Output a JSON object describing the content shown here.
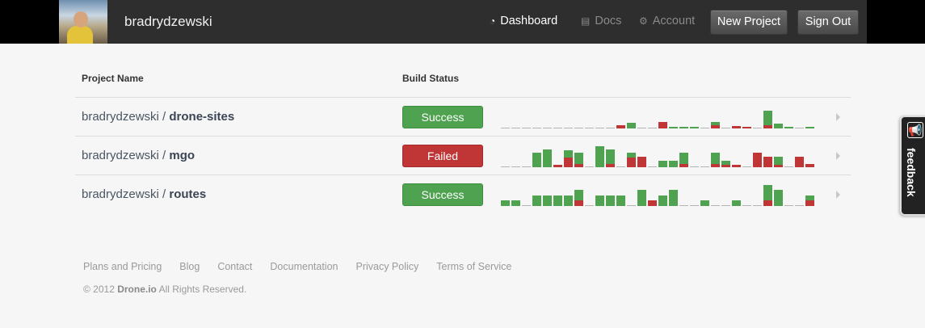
{
  "header": {
    "username": "bradrydzewski",
    "nav": [
      {
        "label": "Dashboard",
        "icon": "dashboard-icon",
        "active": true
      },
      {
        "label": "Docs",
        "icon": "document-icon",
        "active": false
      },
      {
        "label": "Account",
        "icon": "gear-icon",
        "active": false
      }
    ],
    "new_project_label": "New Project",
    "sign_out_label": "Sign Out"
  },
  "table": {
    "col_project": "Project Name",
    "col_status": "Build Status",
    "rows": [
      {
        "owner": "bradrydzewski / ",
        "repo": "drone-sites",
        "status": "Success",
        "status_kind": "success",
        "builds": [
          {
            "r": "p"
          },
          {
            "r": "p"
          },
          {
            "r": "p"
          },
          {
            "r": "p"
          },
          {
            "r": "p"
          },
          {
            "r": "p"
          },
          {
            "r": "p"
          },
          {
            "r": "p"
          },
          {
            "r": "p"
          },
          {
            "r": "p"
          },
          {
            "r": "p"
          },
          {
            "r": "f",
            "h": 0.2
          },
          {
            "r": "s",
            "h": 0.3
          },
          {
            "r": "p"
          },
          {
            "r": "p"
          },
          {
            "r": "f",
            "h": 0.35
          },
          {
            "r": "s",
            "h": 0.08
          },
          {
            "r": "s",
            "h": 0.08
          },
          {
            "r": "s",
            "h": 0.08
          },
          {
            "r": "p"
          },
          {
            "r": "m",
            "h": 0.36,
            "f": 0.18
          },
          {
            "r": "p"
          },
          {
            "r": "f",
            "h": 0.15
          },
          {
            "r": "f",
            "h": 0.1
          },
          {
            "r": "p"
          },
          {
            "r": "m",
            "h": 1.0,
            "f": 0.2
          },
          {
            "r": "s",
            "h": 0.28
          },
          {
            "r": "s",
            "h": 0.08
          },
          {
            "r": "p"
          },
          {
            "r": "s",
            "h": 0.08
          }
        ]
      },
      {
        "owner": "bradrydzewski / ",
        "repo": "mgo",
        "status": "Failed",
        "status_kind": "failed",
        "builds": [
          {
            "r": "p"
          },
          {
            "r": "p"
          },
          {
            "r": "p"
          },
          {
            "r": "s",
            "h": 0.8
          },
          {
            "r": "s",
            "h": 1.0
          },
          {
            "r": "f",
            "h": 0.15
          },
          {
            "r": "m",
            "h": 0.95,
            "f": 0.55
          },
          {
            "r": "m",
            "h": 0.8,
            "f": 0.2
          },
          {
            "r": "p"
          },
          {
            "r": "s",
            "h": 1.2
          },
          {
            "r": "m",
            "h": 1.0,
            "f": 0.2
          },
          {
            "r": "p"
          },
          {
            "r": "m",
            "h": 0.8,
            "f": 0.55
          },
          {
            "r": "f",
            "h": 0.6
          },
          {
            "r": "p"
          },
          {
            "r": "s",
            "h": 0.38
          },
          {
            "r": "s",
            "h": 0.38
          },
          {
            "r": "m",
            "h": 0.8,
            "f": 0.2
          },
          {
            "r": "p"
          },
          {
            "r": "p"
          },
          {
            "r": "m",
            "h": 0.8,
            "f": 0.2
          },
          {
            "r": "m",
            "h": 0.35,
            "f": 0.15
          },
          {
            "r": "f",
            "h": 0.15
          },
          {
            "r": "p"
          },
          {
            "r": "f",
            "h": 0.8
          },
          {
            "r": "m",
            "h": 0.6,
            "f": 0.58
          },
          {
            "r": "m",
            "h": 0.6,
            "f": 0.15
          },
          {
            "r": "p"
          },
          {
            "r": "f",
            "h": 0.6
          },
          {
            "r": "f",
            "h": 0.18
          }
        ]
      },
      {
        "owner": "bradrydzewski / ",
        "repo": "routes",
        "status": "Success",
        "status_kind": "success",
        "builds": [
          {
            "r": "s",
            "h": 0.3
          },
          {
            "r": "s",
            "h": 0.3
          },
          {
            "r": "p"
          },
          {
            "r": "s",
            "h": 0.6
          },
          {
            "r": "s",
            "h": 0.6
          },
          {
            "r": "s",
            "h": 0.6
          },
          {
            "r": "s",
            "h": 0.6
          },
          {
            "r": "m",
            "h": 0.9,
            "f": 0.3
          },
          {
            "r": "p"
          },
          {
            "r": "s",
            "h": 0.6
          },
          {
            "r": "s",
            "h": 0.6
          },
          {
            "r": "s",
            "h": 0.6
          },
          {
            "r": "p"
          },
          {
            "r": "s",
            "h": 0.9
          },
          {
            "r": "f",
            "h": 0.3
          },
          {
            "r": "s",
            "h": 0.6
          },
          {
            "r": "s",
            "h": 0.9
          },
          {
            "r": "p"
          },
          {
            "r": "p"
          },
          {
            "r": "s",
            "h": 0.3
          },
          {
            "r": "p"
          },
          {
            "r": "p"
          },
          {
            "r": "s",
            "h": 0.3
          },
          {
            "r": "p"
          },
          {
            "r": "p"
          },
          {
            "r": "m",
            "h": 1.2,
            "f": 0.3
          },
          {
            "r": "s",
            "h": 0.9
          },
          {
            "r": "p"
          },
          {
            "r": "p"
          },
          {
            "r": "m",
            "h": 0.6,
            "f": 0.3
          }
        ]
      }
    ]
  },
  "footer": {
    "links": [
      "Plans and Pricing",
      "Blog",
      "Contact",
      "Documentation",
      "Privacy Policy",
      "Terms of Service"
    ],
    "copyright_prefix": "© 2012 ",
    "brand": "Drone.io",
    "copyright_suffix": " All Rights Reserved."
  },
  "feedback": {
    "label": "feedback",
    "icon": "megaphone-icon"
  },
  "colors": {
    "success": "#4fa24f",
    "failed": "#c03535",
    "pending": "#b5b5b5",
    "topbar": "#2e2e2e"
  }
}
